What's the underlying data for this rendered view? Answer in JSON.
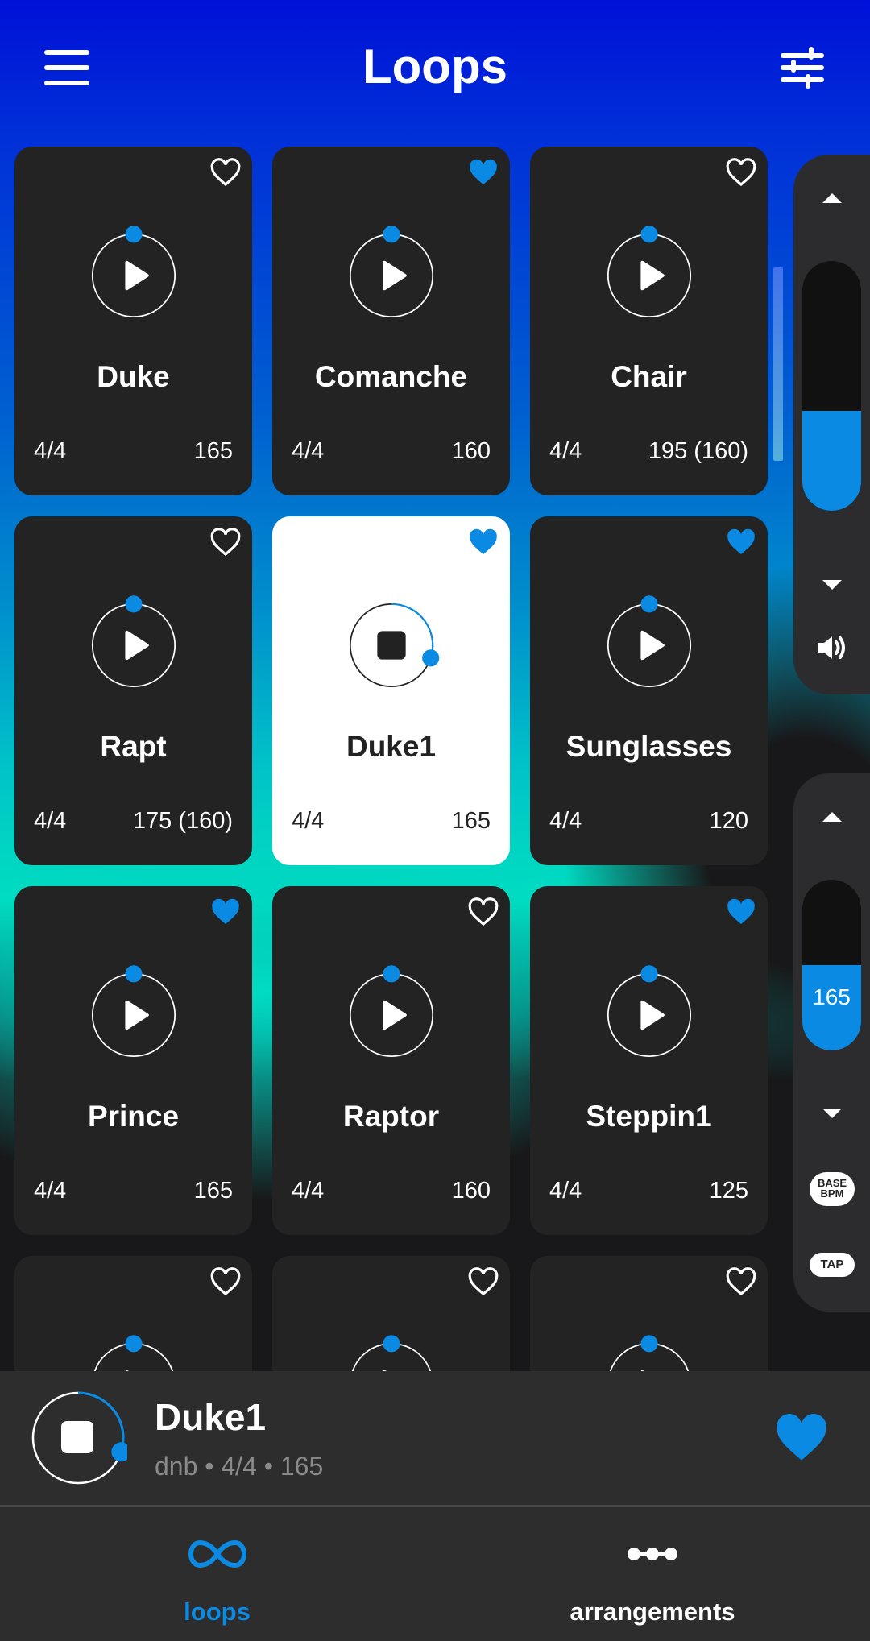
{
  "header": {
    "title": "Loops",
    "menu_icon": "hamburger-menu-icon",
    "filter_icon": "sliders-filter-icon"
  },
  "colors": {
    "accent": "#0a8ae3",
    "card_bg": "#232323",
    "card_active_bg": "#ffffff",
    "panel_bg": "#2c2c2e",
    "nav_bg": "#2d2d2d"
  },
  "loops": [
    {
      "name": "Duke",
      "signature": "4/4",
      "bpm": "165",
      "favorite": false,
      "playing": false
    },
    {
      "name": "Comanche",
      "signature": "4/4",
      "bpm": "160",
      "favorite": true,
      "playing": false
    },
    {
      "name": "Chair",
      "signature": "4/4",
      "bpm": "195 (160)",
      "favorite": false,
      "playing": false
    },
    {
      "name": "Rapt",
      "signature": "4/4",
      "bpm": "175 (160)",
      "favorite": false,
      "playing": false
    },
    {
      "name": "Duke1",
      "signature": "4/4",
      "bpm": "165",
      "favorite": true,
      "playing": true,
      "progress": 0.3
    },
    {
      "name": "Sunglasses",
      "signature": "4/4",
      "bpm": "120",
      "favorite": true,
      "playing": false
    },
    {
      "name": "Prince",
      "signature": "4/4",
      "bpm": "165",
      "favorite": true,
      "playing": false
    },
    {
      "name": "Raptor",
      "signature": "4/4",
      "bpm": "160",
      "favorite": false,
      "playing": false
    },
    {
      "name": "Steppin1",
      "signature": "4/4",
      "bpm": "125",
      "favorite": true,
      "playing": false
    },
    {
      "name": "",
      "signature": "",
      "bpm": "",
      "favorite": false,
      "playing": false
    },
    {
      "name": "",
      "signature": "",
      "bpm": "",
      "favorite": false,
      "playing": false
    },
    {
      "name": "",
      "signature": "",
      "bpm": "",
      "favorite": false,
      "playing": false
    }
  ],
  "volume_panel": {
    "level": 0.4,
    "up_icon": "arrow-up-icon",
    "down_icon": "arrow-down-icon",
    "speaker_icon": "speaker-icon"
  },
  "tempo_panel": {
    "value": "165",
    "level": 0.5,
    "base_bpm_label_line1": "BASE",
    "base_bpm_label_line2": "BPM",
    "tap_label": "TAP"
  },
  "now_playing": {
    "title": "Duke1",
    "subtitle": "dnb • 4/4 • 165",
    "favorite": true,
    "progress": 0.3
  },
  "bottom_nav": [
    {
      "label": "loops",
      "icon": "infinity-loop-icon",
      "active": true
    },
    {
      "label": "arrangements",
      "icon": "arrangement-dots-icon",
      "active": false
    }
  ]
}
